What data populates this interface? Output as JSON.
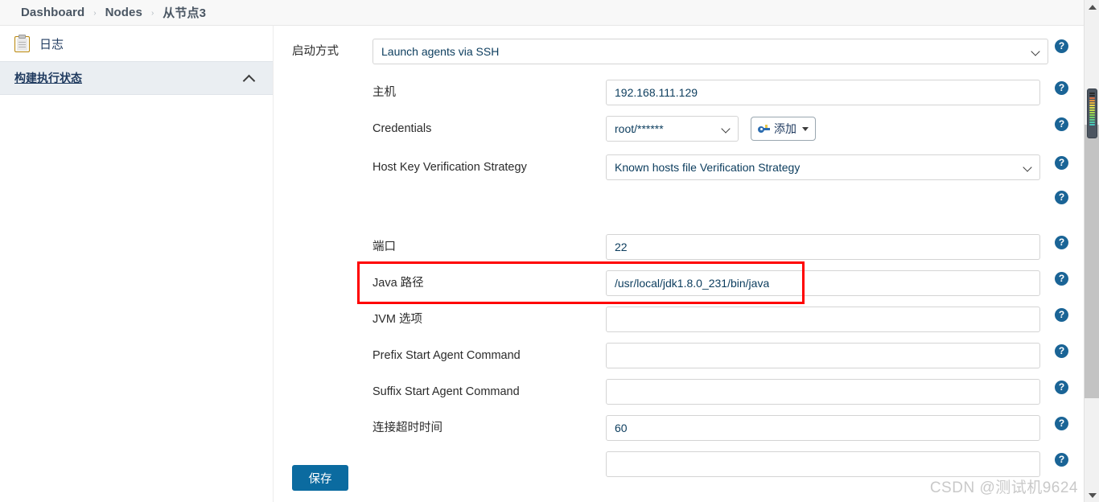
{
  "breadcrumb": {
    "items": [
      "Dashboard",
      "Nodes",
      "从节点3"
    ],
    "separator": "›"
  },
  "sidebar": {
    "items": [
      {
        "label": "日志",
        "icon": "clipboard-icon"
      }
    ],
    "section": {
      "label": "构建执行状态",
      "collapse_icon": "chevron-up-icon"
    }
  },
  "form": {
    "launch_method": {
      "label": "启动方式",
      "value": "Launch agents via SSH"
    },
    "host": {
      "label": "主机",
      "value": "192.168.111.129"
    },
    "credentials": {
      "label": "Credentials",
      "value": "root/******",
      "add_button": "添加"
    },
    "host_key_strategy": {
      "label": "Host Key Verification Strategy",
      "value": "Known hosts file Verification Strategy"
    },
    "port": {
      "label": "端口",
      "value": "22"
    },
    "java_path": {
      "label": "Java 路径",
      "value": "/usr/local/jdk1.8.0_231/bin/java",
      "highlighted": true
    },
    "jvm_options": {
      "label": "JVM 选项",
      "value": ""
    },
    "prefix_start_agent_command": {
      "label": "Prefix Start Agent Command",
      "value": ""
    },
    "suffix_start_agent_command": {
      "label": "Suffix Start Agent Command",
      "value": ""
    },
    "connection_timeout": {
      "label": "连接超时时间",
      "value": "60"
    },
    "help_icon_glyph": "?"
  },
  "actions": {
    "save_label": "保存"
  },
  "watermark": {
    "text": "CSDN @测试机9624"
  },
  "colors": {
    "accent": "#0b6ba0",
    "help": "#1a6496",
    "highlight": "#ff0000",
    "sidebar_section_bg": "#eaeef2"
  }
}
